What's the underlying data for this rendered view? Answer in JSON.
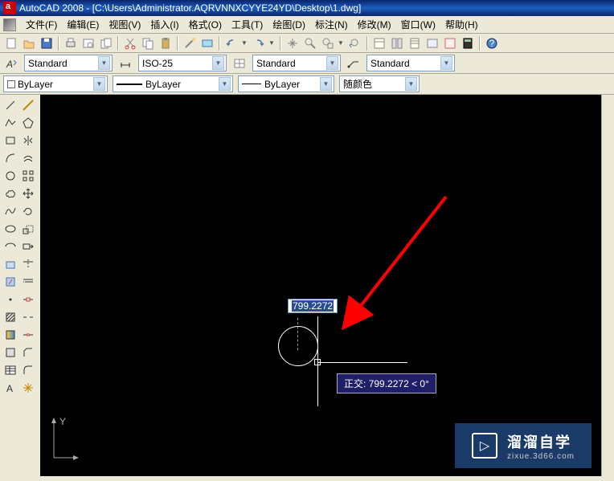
{
  "title": "AutoCAD 2008 - [C:\\Users\\Administrator.AQRVNNXCYYE24YD\\Desktop\\1.dwg]",
  "menus": [
    "文件(F)",
    "编辑(E)",
    "视图(V)",
    "插入(I)",
    "格式(O)",
    "工具(T)",
    "绘图(D)",
    "标注(N)",
    "修改(M)",
    "窗口(W)",
    "帮助(H)"
  ],
  "style_bar": {
    "text_style": "Standard",
    "dim_style": "ISO-25",
    "table_style": "Standard",
    "mls_style": "Standard"
  },
  "layer_bar": {
    "layer": "ByLayer",
    "linetype": "ByLayer",
    "lineweight": "ByLayer",
    "color": "随颜色"
  },
  "dynamic_input": "799.2272",
  "tooltip_label": "正交:",
  "tooltip_value": "799.2272 < 0°",
  "watermark": {
    "main": "溜溜自学",
    "sub": "zixue.3d66.com"
  }
}
